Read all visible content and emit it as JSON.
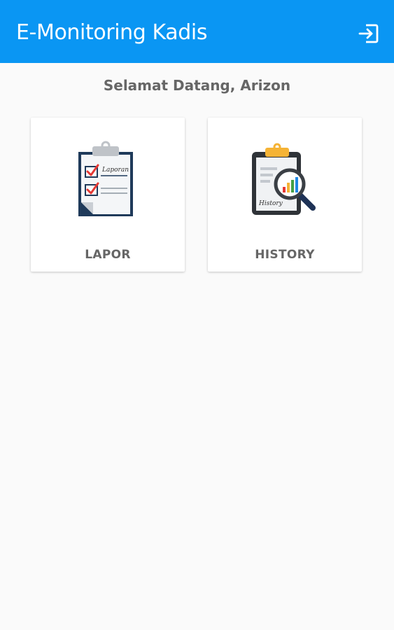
{
  "app_bar": {
    "title": "E-Monitoring Kadis",
    "background_color": "#0a96f3",
    "logout_icon": "logout-icon"
  },
  "welcome_text": "Selamat Datang, Arizon",
  "menu": [
    {
      "label": "LAPOR",
      "icon": "report-clipboard-icon",
      "icon_text": "Laporan"
    },
    {
      "label": "HISTORY",
      "icon": "history-clipboard-icon",
      "icon_text": "History"
    }
  ]
}
